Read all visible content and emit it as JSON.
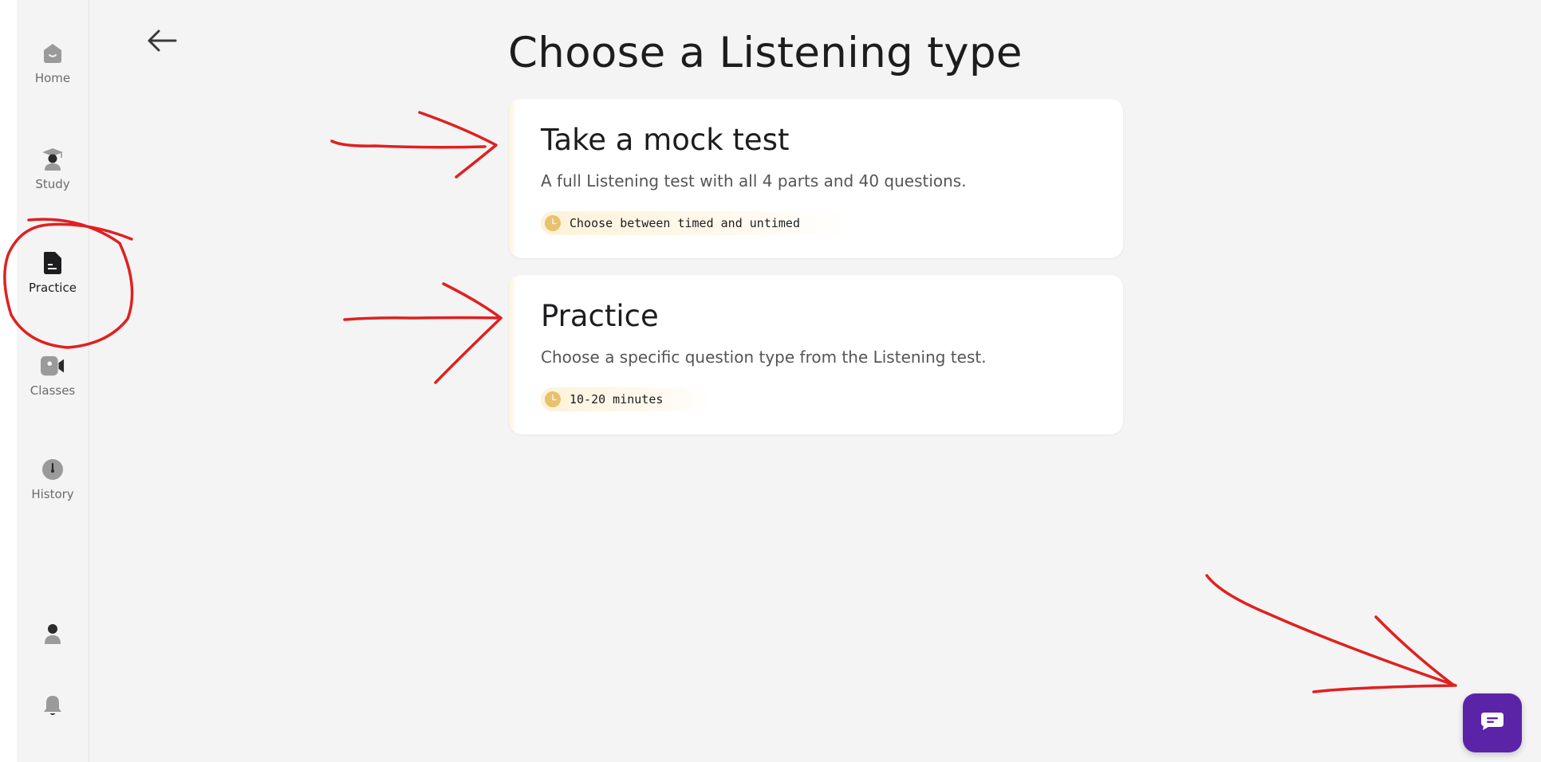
{
  "sidebar": {
    "items": [
      {
        "label": "Home",
        "icon": "home-icon"
      },
      {
        "label": "Study",
        "icon": "graduation-cap-icon"
      },
      {
        "label": "Practice",
        "icon": "document-icon",
        "active": true
      },
      {
        "label": "Classes",
        "icon": "video-camera-icon"
      },
      {
        "label": "History",
        "icon": "clock-icon"
      }
    ],
    "bottom": [
      {
        "icon": "user-icon"
      },
      {
        "icon": "bell-icon"
      }
    ]
  },
  "header": {
    "back_icon": "arrow-left-icon",
    "title": "Choose a Listening type"
  },
  "cards": [
    {
      "title": "Take a mock test",
      "description": "A full Listening test with all 4 parts and 40 questions.",
      "badge": "Choose between timed and untimed"
    },
    {
      "title": "Practice",
      "description": "Choose a specific question type from the Listening test.",
      "badge": "10-20 minutes"
    }
  ],
  "chat": {
    "icon": "chat-icon"
  },
  "colors": {
    "background": "#f4f4f4",
    "card": "#ffffff",
    "badge": "#fdf2da",
    "clock": "#e8c06e",
    "chat_button": "#5b24a8",
    "annotation": "#e02020"
  }
}
